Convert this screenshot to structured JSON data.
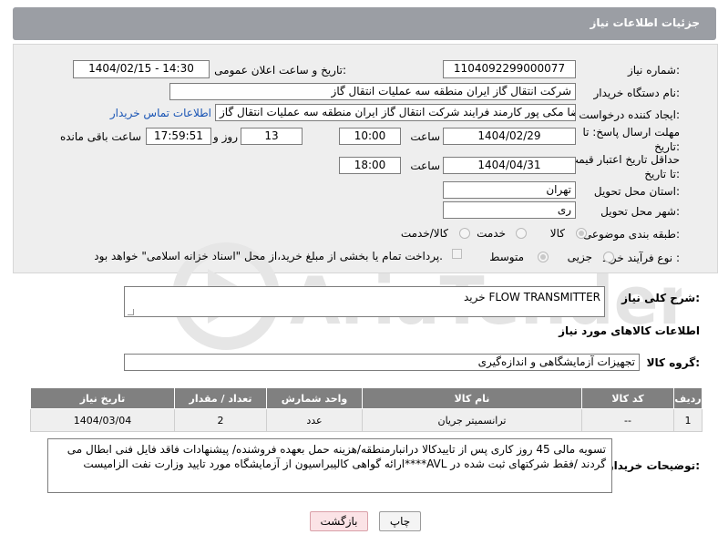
{
  "header": {
    "title": "جزئیات اطلاعات نیاز"
  },
  "form": {
    "need_number_label": "شماره نیاز:",
    "need_number": "1104092299000077",
    "announce_label": "تاریخ و ساعت اعلان عمومی:",
    "announce_value": "1404/02/15 - 14:30",
    "buyer_org_label": "نام دستگاه خریدار:",
    "buyer_org": "شرکت انتقال گاز ایران منطقه سه عملیات انتقال گاز",
    "creator_label": "ایجاد کننده درخواست:",
    "creator": "رضا مکی پور کارمند فرایند شرکت انتقال گاز ایران منطقه سه عملیات انتقال گاز",
    "contact_link": "اطلاعات تماس خریدار",
    "deadline_label": "مهلت ارسال پاسخ: تا تاریخ:",
    "deadline_date": "1404/02/29",
    "time_label": "ساعت",
    "deadline_time": "10:00",
    "days_value": "13",
    "days_label": "روز و",
    "remaining_value": "17:59:51",
    "remaining_label": "ساعت باقی مانده",
    "price_validity_label": "حداقل تاریخ اعتبار قیمت: تا تاریخ:",
    "price_date": "1404/04/31",
    "price_time": "18:00",
    "province_label": "استان محل تحویل:",
    "province": "تهران",
    "city_label": "شهر محل تحویل:",
    "city": "ری",
    "category_label": "طبقه بندی موضوعی:",
    "category_options": [
      "کالا",
      "خدمت",
      "کالا/خدمت"
    ],
    "process_label": "نوع فرآیند خرید :",
    "process_options": [
      "جزیی",
      "متوسط"
    ],
    "payment_note": "پرداخت تمام یا بخشی از مبلغ خرید،از محل \"اسناد خزانه اسلامی\" خواهد بود."
  },
  "summary": {
    "label": "شرح کلی نیاز:",
    "value": "خرید FLOW TRANSMITTER"
  },
  "goods_info": {
    "title": "اطلاعات کالاهای مورد نیاز"
  },
  "goods_group": {
    "label": "گروه کالا:",
    "value": "تجهیزات آزمایشگاهی و اندازه‌گیری"
  },
  "table": {
    "headers": [
      "ردیف",
      "کد کالا",
      "نام کالا",
      "واحد شمارش",
      "تعداد / مقدار",
      "تاریخ نیاز"
    ],
    "rows": [
      [
        "1",
        "--",
        "ترانسمیتر جریان",
        "عدد",
        "2",
        "1404/03/04"
      ]
    ]
  },
  "notes": {
    "label": "توضیحات خریدار:",
    "value": "تسویه مالی 45 روز کاری پس از تاییدکالا درانبارمنطقه/هزینه حمل بعهده فروشنده/ پیشنهادات فاقد فایل فنی ابطال می گردند  /فقط شرکتهای ثبت شده در AVL****ارائه گواهی کالیبراسیون از آزمایشگاه مورد تایید وزارت نفت الزامیست"
  },
  "buttons": {
    "print": "چاپ",
    "back": "بازگشت"
  },
  "watermark": {
    "text": "AriaTender.neT"
  },
  "colors": {
    "header_bg": "#9b9ea4",
    "link": "#1a55b5",
    "table_header": "#808080"
  }
}
